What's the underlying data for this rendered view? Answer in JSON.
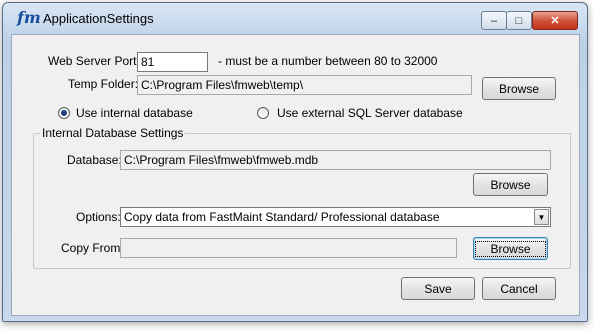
{
  "window": {
    "title": "ApplicationSettings",
    "app_icon": "fm"
  },
  "caption": {
    "minimize": "–",
    "maximize": "□",
    "close": "✕"
  },
  "web_server_port": {
    "label": "Web Server Port:",
    "value": "81",
    "hint": "- must be a number between 80 to 32000"
  },
  "temp_folder": {
    "label": "Temp Folder:",
    "value": "C:\\Program Files\\fmweb\\temp\\",
    "browse": "Browse"
  },
  "db_choice": {
    "internal": "Use internal database",
    "external": "Use external SQL Server database",
    "selected": "internal"
  },
  "internal_db": {
    "group_title": "Internal Database Settings",
    "database_label": "Database:",
    "database_value": "C:\\Program Files\\fmweb\\fmweb.mdb",
    "browse": "Browse",
    "options_label": "Options:",
    "options_value": "Copy data from FastMaint Standard/ Professional database",
    "copy_from_label": "Copy From:",
    "copy_from_value": "",
    "copy_browse": "Browse"
  },
  "footer": {
    "save": "Save",
    "cancel": "Cancel"
  }
}
